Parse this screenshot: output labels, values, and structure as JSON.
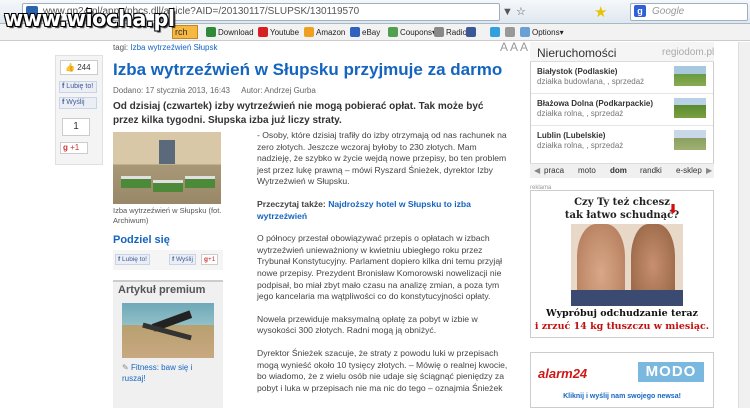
{
  "browser": {
    "url": "www.gp24.pl/apps/pbcs.dll/article?AID=/20130117/SLUPSK/130119570",
    "search_placeholder": "Google",
    "controls": "▼ ☆",
    "toolbar_items": [
      "Download",
      "Youtube",
      "Amazon",
      "eBay",
      "Coupons",
      "Radio",
      "Options"
    ],
    "toolbar_search": "rch"
  },
  "watermark": "www.wiocha.pl",
  "social_left": {
    "like_count": "244",
    "fb_like": "Lubię to!",
    "send": "Wyślij",
    "plusone_count": "1",
    "gplus": "+1"
  },
  "article": {
    "tags_label": "tagi:",
    "tags_value": "Izba wytrzeźwień Słupsk",
    "font_controls": "A A A",
    "title": "Izba wytrzeźwień w Słupsku przyjmuje za darmo",
    "date": "Dodano: 17 stycznia 2013, 16:43",
    "author": "Autor: Andrzej Gurba",
    "lead": "Od dzisiaj (czwartek) izby wytrzeźwień nie mogą pobierać opłat. Tak może być przez kilka tygodni. Słupska izba już liczy straty.",
    "photo_caption": "Izba wytrzeźwień w Słupsku (fot. Archiwum)",
    "body": [
      "- Osoby, które dzisiaj trafiły do izby otrzymają od nas rachunek na zero złotych. Jeszcze wczoraj byłoby to 230 złotych. Mam nadzieję, że szybko w życie wejdą nowe przepisy, bo ten problem jest przez lukę prawną – mówi Ryszard Śnieżek, dyrektor Izby Wytrzeźwień w Słupsku.",
      "O północy przestał obowiązywać przepis o opłatach w izbach wytrzeźwień unieważniony w kwietniu ubiegłego roku przez Trybunał Konstytucyjny. Parlament dopiero kilka dni temu przyjął nowe przepisy. Prezydent Bronisław Komorowski nowelizacji nie podpisał, bo miał zbyt mało czasu na analizę zmian, a poza tym jego kancelaria ma wątpliwości co do konstytucyjności opłaty.",
      "Nowela przewiduje maksymalną opłatę za pobyt w izbie w wysokości 300 złotych. Radni mogą ją obniżyć.",
      "Dyrektor Śnieżek szacuje, że straty z powodu luki w przepisach mogą wynieść około 10 tysięcy złotych. – Mówię o realnej kwocie, bo wiadomo, że z wielu osób nie udaje się ściągnąć pieniędzy za pobyt i luka w przepisach nie ma nic do tego – oznajmia Śnieżek"
    ],
    "related_label": "Przeczytaj także:",
    "related_link": "Najdroższy hotel w Słupsku to izba wytrzeźwień"
  },
  "share": {
    "heading": "Podziel się",
    "fb": "Lubię to!",
    "send": "Wyślij",
    "gplus": "+1"
  },
  "premium": {
    "heading": "Artykuł premium",
    "link": "Fitness: baw się i ruszaj!"
  },
  "realestate": {
    "heading": "Nieruchomości",
    "brand": "regiodom.pl",
    "items": [
      {
        "title": "Białystok (Podlaskie)",
        "desc": "działka budowlana, , sprzedaż"
      },
      {
        "title": "Błażowa Dolna (Podkarpackie)",
        "desc": "działka rolna, , sprzedaż"
      },
      {
        "title": "Lublin (Lubelskie)",
        "desc": "działka rolna, , sprzedaż"
      }
    ],
    "tabs": [
      "◀",
      "praca",
      "moto",
      "dom",
      "randki",
      "e-sklep",
      "▶"
    ]
  },
  "ad": {
    "label": "reklama",
    "headline1": "Czy Ty też chcesz",
    "headline2": "tak łatwo schudnąć?",
    "line1": "Wypróbuj odchudzanie teraz",
    "line2": "i zrzuć 14 kg tłuszczu w miesiąc."
  },
  "alarm": {
    "logo": "alarm24",
    "modo": "MODO",
    "link": "Kliknij i wyślij nam swojego newsa!"
  }
}
